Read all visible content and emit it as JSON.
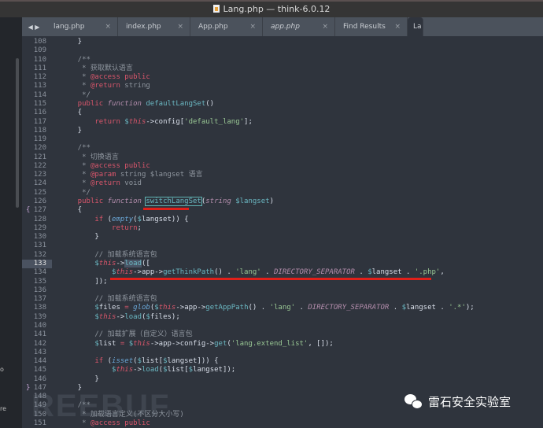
{
  "window": {
    "title": "Lang.php — think-6.0.12"
  },
  "sidebar": {
    "fragments": [
      "o",
      "re"
    ]
  },
  "tabs": [
    {
      "label": "lang.php"
    },
    {
      "label": "index.php"
    },
    {
      "label": "App.php"
    },
    {
      "label": "app.php",
      "italic": true
    },
    {
      "label": "Find Results"
    },
    {
      "label": "La",
      "active": true
    }
  ],
  "tab_close": "×",
  "nav": "◀ ▶",
  "editor": {
    "current_line": 133,
    "lines": [
      [
        108,
        [
          [
            "p",
            "    }"
          ]
        ]
      ],
      [
        109,
        []
      ],
      [
        110,
        [
          [
            "c",
            "    /**"
          ]
        ]
      ],
      [
        111,
        [
          [
            "c",
            "     * 获取默认语言"
          ]
        ]
      ],
      [
        112,
        [
          [
            "c",
            "     * "
          ],
          [
            "k",
            "@access"
          ],
          [
            "c",
            " "
          ],
          [
            "k",
            "public"
          ]
        ]
      ],
      [
        113,
        [
          [
            "c",
            "     * "
          ],
          [
            "k",
            "@return"
          ],
          [
            "c",
            " string"
          ]
        ]
      ],
      [
        114,
        [
          [
            "c",
            "     */"
          ]
        ]
      ],
      [
        115,
        [
          [
            "k",
            "    public "
          ],
          [
            "f",
            "function "
          ],
          [
            "fn",
            "defaultLangSet"
          ],
          [
            "p",
            "()"
          ]
        ]
      ],
      [
        116,
        [
          [
            "p",
            "    {"
          ]
        ]
      ],
      [
        117,
        [
          [
            "k",
            "        return "
          ],
          [
            "v",
            "$"
          ],
          [
            "th",
            "this"
          ],
          [
            "p",
            "->config["
          ],
          [
            "s",
            "'default_lang'"
          ],
          [
            "p",
            "];"
          ]
        ]
      ],
      [
        118,
        [
          [
            "p",
            "    }"
          ]
        ]
      ],
      [
        119,
        []
      ],
      [
        120,
        [
          [
            "c",
            "    /**"
          ]
        ]
      ],
      [
        121,
        [
          [
            "c",
            "     * 切换语言"
          ]
        ]
      ],
      [
        122,
        [
          [
            "c",
            "     * "
          ],
          [
            "k",
            "@access"
          ],
          [
            "c",
            " "
          ],
          [
            "k",
            "public"
          ]
        ]
      ],
      [
        123,
        [
          [
            "c",
            "     * "
          ],
          [
            "k",
            "@param"
          ],
          [
            "c",
            " string $langset 语言"
          ]
        ]
      ],
      [
        124,
        [
          [
            "c",
            "     * "
          ],
          [
            "k",
            "@return"
          ],
          [
            "c",
            " void"
          ]
        ]
      ],
      [
        125,
        [
          [
            "c",
            "     */"
          ]
        ]
      ],
      [
        126,
        [
          [
            "k",
            "    public "
          ],
          [
            "f",
            "function "
          ],
          [
            "fn hl",
            "switchLangSet"
          ],
          [
            "p",
            "("
          ],
          [
            "f",
            "string "
          ],
          [
            "v",
            "$langset"
          ],
          [
            "p",
            ")"
          ]
        ]
      ],
      [
        127,
        [
          [
            "p",
            "    {"
          ]
        ],
        "{"
      ],
      [
        128,
        [
          [
            "k",
            "        if "
          ],
          [
            "p",
            "("
          ],
          [
            "bi",
            "empty"
          ],
          [
            "p",
            "("
          ],
          [
            "v",
            "$"
          ],
          [
            "p",
            "langset)) {"
          ]
        ]
      ],
      [
        129,
        [
          [
            "k",
            "            return"
          ],
          [
            "p",
            ";"
          ]
        ]
      ],
      [
        130,
        [
          [
            "p",
            "        }"
          ]
        ]
      ],
      [
        131,
        []
      ],
      [
        132,
        [
          [
            "c",
            "        // 加载系统语言包"
          ]
        ]
      ],
      [
        133,
        [
          [
            "v",
            "        $"
          ],
          [
            "th",
            "this"
          ],
          [
            "p",
            "->"
          ],
          [
            "fn sel",
            "load"
          ],
          [
            "p",
            "(["
          ]
        ]
      ],
      [
        134,
        [
          [
            "v",
            "            $"
          ],
          [
            "th",
            "this"
          ],
          [
            "p",
            "->app->"
          ],
          [
            "fn",
            "getThinkPath"
          ],
          [
            "p",
            "() . "
          ],
          [
            "s",
            "'lang'"
          ],
          [
            "p",
            " . "
          ],
          [
            "cn",
            "DIRECTORY_SEPARATOR"
          ],
          [
            "p",
            " . "
          ],
          [
            "v",
            "$"
          ],
          [
            "p",
            "langset . "
          ],
          [
            "s",
            "'.php'"
          ],
          [
            "p",
            ","
          ]
        ]
      ],
      [
        135,
        [
          [
            "p",
            "        ]);"
          ]
        ]
      ],
      [
        136,
        []
      ],
      [
        137,
        [
          [
            "c",
            "        // 加载系统语言包"
          ]
        ]
      ],
      [
        138,
        [
          [
            "v",
            "        $"
          ],
          [
            "p",
            "files "
          ],
          [
            "k",
            "="
          ],
          [
            "p",
            " "
          ],
          [
            "bi",
            "glob"
          ],
          [
            "p",
            "("
          ],
          [
            "v",
            "$"
          ],
          [
            "th",
            "this"
          ],
          [
            "p",
            "->app->"
          ],
          [
            "fn",
            "getAppPath"
          ],
          [
            "p",
            "() . "
          ],
          [
            "s",
            "'lang'"
          ],
          [
            "p",
            " . "
          ],
          [
            "cn",
            "DIRECTORY_SEPARATOR"
          ],
          [
            "p",
            " . "
          ],
          [
            "v",
            "$"
          ],
          [
            "p",
            "langset . "
          ],
          [
            "s",
            "'.*'"
          ],
          [
            "p",
            ");"
          ]
        ]
      ],
      [
        139,
        [
          [
            "v",
            "        $"
          ],
          [
            "th",
            "this"
          ],
          [
            "p",
            "->"
          ],
          [
            "fn",
            "load"
          ],
          [
            "p",
            "("
          ],
          [
            "v",
            "$"
          ],
          [
            "p",
            "files);"
          ]
        ]
      ],
      [
        140,
        []
      ],
      [
        141,
        [
          [
            "c",
            "        // 加载扩展（自定义）语言包"
          ]
        ]
      ],
      [
        142,
        [
          [
            "v",
            "        $"
          ],
          [
            "p",
            "list "
          ],
          [
            "k",
            "="
          ],
          [
            "p",
            " "
          ],
          [
            "v",
            "$"
          ],
          [
            "th",
            "this"
          ],
          [
            "p",
            "->app->config->"
          ],
          [
            "fn",
            "get"
          ],
          [
            "p",
            "("
          ],
          [
            "s",
            "'lang.extend_list'"
          ],
          [
            "p",
            ", []);"
          ]
        ]
      ],
      [
        143,
        []
      ],
      [
        144,
        [
          [
            "k",
            "        if "
          ],
          [
            "p",
            "("
          ],
          [
            "bi",
            "isset"
          ],
          [
            "p",
            "("
          ],
          [
            "v",
            "$"
          ],
          [
            "p",
            "list["
          ],
          [
            "v",
            "$"
          ],
          [
            "p",
            "langset])) {"
          ]
        ]
      ],
      [
        145,
        [
          [
            "v",
            "            $"
          ],
          [
            "th",
            "this"
          ],
          [
            "p",
            "->"
          ],
          [
            "fn",
            "load"
          ],
          [
            "p",
            "("
          ],
          [
            "v",
            "$"
          ],
          [
            "p",
            "list["
          ],
          [
            "v",
            "$"
          ],
          [
            "p",
            "langset]);"
          ]
        ]
      ],
      [
        146,
        [
          [
            "p",
            "        }"
          ]
        ]
      ],
      [
        147,
        [
          [
            "p",
            "    }"
          ]
        ],
        "}"
      ],
      [
        148,
        []
      ],
      [
        149,
        [
          [
            "c",
            "    /**"
          ]
        ]
      ],
      [
        150,
        [
          [
            "c",
            "     * 加载语言定义(不区分大小写)"
          ]
        ]
      ],
      [
        151,
        [
          [
            "c",
            "     * "
          ],
          [
            "k",
            "@access"
          ],
          [
            "c",
            " "
          ],
          [
            "k",
            "public"
          ]
        ]
      ]
    ]
  },
  "watermark": {
    "text": "REEBUF",
    "badge": "雷石安全实验室"
  }
}
